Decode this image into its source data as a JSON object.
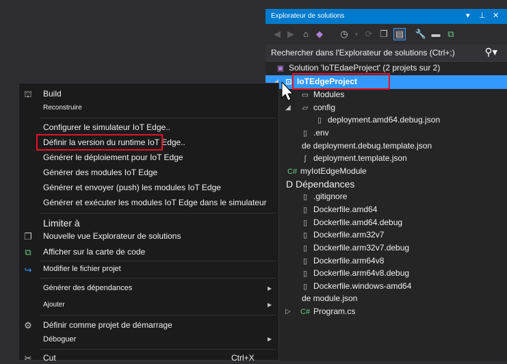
{
  "solution_explorer": {
    "title": "Explorateur de solutions",
    "title_controls": [
      "▾",
      "⊥",
      "✕"
    ],
    "toolbar_icons": [
      "back-icon",
      "forward-icon",
      "home-icon",
      "vs-icon",
      "history-icon",
      "sync-icon",
      "collapse-icon",
      "show-all-files-icon",
      "properties-icon",
      "pending-changes-icon",
      "view-class-diagram-icon"
    ],
    "search_placeholder": "Rechercher dans l'Explorateur de solutions (Ctrl+;)",
    "tree": {
      "solution": "Solution 'IoTEdaeProject' (2 projets sur 2)",
      "project": "IoTEdgeProject",
      "modules": "Modules",
      "config": "config",
      "deployment_amd64_debug": "deployment.amd64.debug.json",
      "env": ".env",
      "deployment_debug_template": "de deployment.debug.template.json",
      "deployment_template": "deployment.template.json",
      "my_module": "myIotEdgeModule",
      "dependances": "D Dépendances",
      "gitignore": ".gitignore",
      "dockerfile_amd64": "Dockerfile.amd64",
      "dockerfile_amd64_debug": "Dockerfile.amd64.debug",
      "dockerfile_arm32v7": "Dockerfile.arm32v7",
      "dockerfile_arm32v7_debug": "Dockerfile.arm32v7.debug",
      "dockerfile_arm64v8": "Dockerfile.arm64v8",
      "dockerfile_arm64v8_debug": "Dockerfile.arm64v8.debug",
      "dockerfile_windows_amd64": "Dockerfile.windows-amd64",
      "module_json": "de module.json",
      "program_cs": "Program.cs"
    }
  },
  "context_menu": {
    "build": "Build",
    "rebuild": "Reconstruire",
    "configure_simulator": "Configurer le simulateur IoT Edge..",
    "set_runtime_version": "Définir la version du runtime IoT Edge..",
    "generate_deployment": "Générer le déploiement pour IoT Edge",
    "build_modules": "Générer des modules IoT Edge",
    "build_push_modules": "Générer et envoyer (push) les modules IoT Edge",
    "build_run_simulator": "Générer et exécuter les modules IoT Edge dans le simulateur",
    "scope_to": "Limiter à",
    "new_explorer_view": "Nouvelle vue Explorateur de solutions",
    "show_code_map": "Afficher sur la carte de code",
    "edit_project_file": "Modifier le fichier projet",
    "build_dependencies": "Générer des dépendances",
    "add": "Ajouter",
    "set_startup": "Définir comme projet de démarrage",
    "debug": "Déboguer",
    "cut": "Cut",
    "cut_shortcut": "Ctrl+X"
  },
  "colors": {
    "accent": "#007acc",
    "selection": "#3399ff",
    "highlight_box": "#e81123"
  }
}
